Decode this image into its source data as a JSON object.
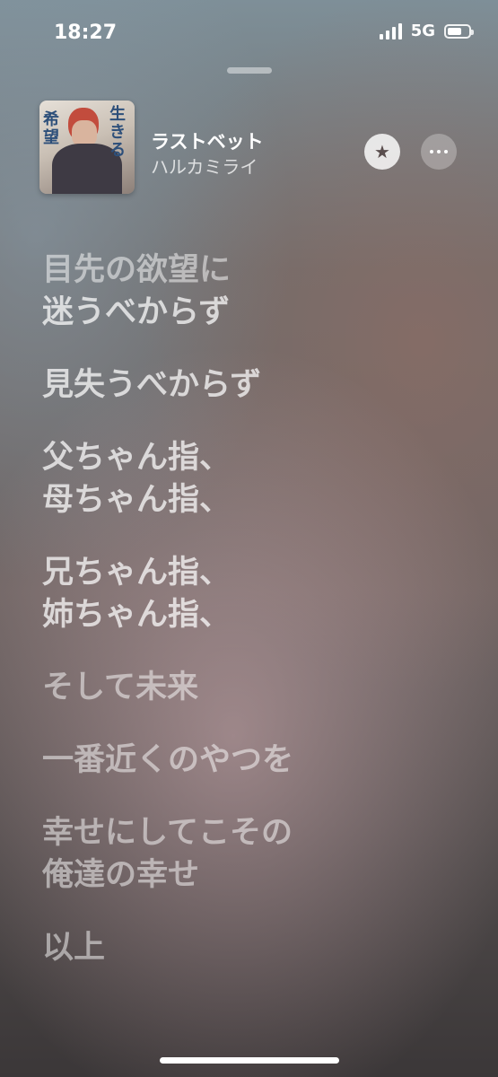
{
  "status_bar": {
    "time": "18:27",
    "network": "5G",
    "signal_bars": 4,
    "battery_level": 0.7
  },
  "now_playing": {
    "title": "ラストベット",
    "artist": "ハルカミライ",
    "artwork_text_left": "希望",
    "artwork_text_right": "生きる",
    "star_icon": "star-icon",
    "more_icon": "ellipsis-icon"
  },
  "lyrics": [
    [
      "目先の欲望に",
      "迷うべからず"
    ],
    [
      "見失うべからず"
    ],
    [
      "父ちゃん指、",
      "母ちゃん指、"
    ],
    [
      "兄ちゃん指、",
      "姉ちゃん指、"
    ],
    [
      "そして未来"
    ],
    [
      "一番近くのやつを"
    ],
    [
      "幸せにしてこその",
      "俺達の幸せ"
    ],
    [
      "以上"
    ]
  ]
}
